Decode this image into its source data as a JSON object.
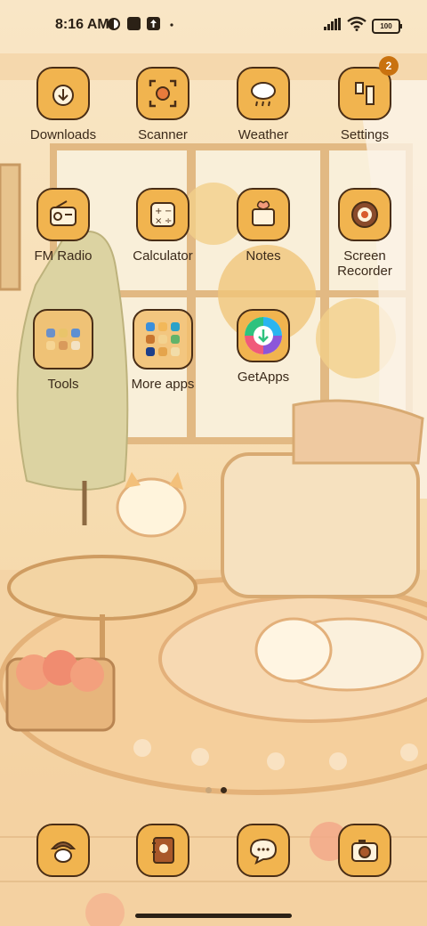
{
  "status_bar": {
    "time": "8:16 AM",
    "battery": "100"
  },
  "apps_row1": [
    {
      "label": "Downloads"
    },
    {
      "label": "Scanner"
    },
    {
      "label": "Weather"
    },
    {
      "label": "Settings",
      "badge": "2"
    }
  ],
  "apps_row2": [
    {
      "label": "FM Radio"
    },
    {
      "label": "Calculator"
    },
    {
      "label": "Notes"
    },
    {
      "label": "Screen\nRecorder"
    }
  ],
  "apps_row3": [
    {
      "label": "Tools"
    },
    {
      "label": "More apps"
    },
    {
      "label": "GetApps"
    }
  ],
  "page_indicator": {
    "total": 2,
    "active": 2
  },
  "colors": {
    "tile": "#f1b44f",
    "outline": "#4a2e16",
    "text": "#3b2a1a",
    "badge": "#c9720f"
  },
  "dock": [
    {
      "icon": "cat-phone-icon"
    },
    {
      "icon": "contacts-book-icon"
    },
    {
      "icon": "message-bubble-icon"
    },
    {
      "icon": "camera-icon"
    }
  ]
}
